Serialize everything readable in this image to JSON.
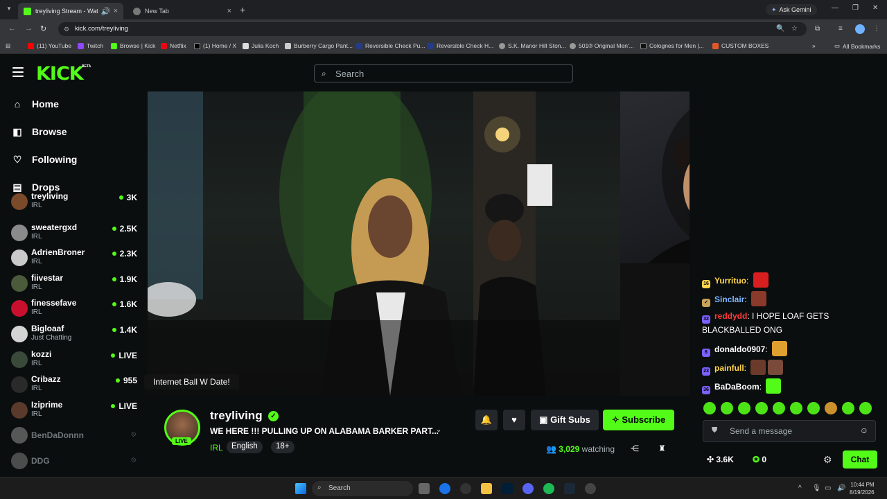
{
  "browser": {
    "tabs": [
      {
        "title": "treyliving Stream - Watch L",
        "active": true
      },
      {
        "title": "New Tab",
        "active": false
      }
    ],
    "ask_gemini": "Ask Gemini",
    "url": "kick.com/treyliving",
    "bookmarks": [
      "(11) YouTube",
      "Twitch",
      "Browse | Kick",
      "Netflix",
      "(1) Home / X",
      "Julia Koch",
      "Burberry Cargo Pant...",
      "Reversible Check Pu...",
      "Reversible Check H...",
      "S.K. Manor Hill Ston...",
      "501® Original Men'...",
      "Colognes for Men |...",
      "CUSTOM BOXES"
    ],
    "all_bookmarks": "All Bookmarks"
  },
  "kick": {
    "logo": "KICK",
    "beta": "BETA",
    "search_placeholder": "Search"
  },
  "sidebar": {
    "nav": [
      {
        "label": "Home",
        "icon": "home-icon"
      },
      {
        "label": "Browse",
        "icon": "browse-icon"
      },
      {
        "label": "Following",
        "icon": "heart-icon"
      },
      {
        "label": "Drops",
        "icon": "drops-icon"
      }
    ],
    "channels": [
      {
        "name": "treyliving",
        "category": "IRL",
        "viewers": "3K",
        "live": true,
        "color": "#7a4a2a"
      },
      {
        "name": "sweatergxd",
        "category": "IRL",
        "viewers": "2.5K",
        "live": true,
        "color": "#8a8a8a"
      },
      {
        "name": "AdrienBroner",
        "category": "IRL",
        "viewers": "2.3K",
        "live": true,
        "color": "#c9c9c9"
      },
      {
        "name": "fiivestar",
        "category": "IRL",
        "viewers": "1.9K",
        "live": true,
        "color": "#4a5a3a"
      },
      {
        "name": "finessefave",
        "category": "IRL",
        "viewers": "1.6K",
        "live": true,
        "color": "#c8102e"
      },
      {
        "name": "Bigloaaf",
        "category": "Just Chatting",
        "viewers": "1.4K",
        "live": true,
        "color": "#d4d4d4"
      },
      {
        "name": "kozzi",
        "category": "IRL",
        "viewers": "LIVE",
        "live": true,
        "color": "#3a4a3a"
      },
      {
        "name": "Cribazz",
        "category": "IRL",
        "viewers": "955",
        "live": true,
        "color": "#2a2a2a"
      },
      {
        "name": "Iziprime",
        "category": "IRL",
        "viewers": "LIVE",
        "live": true,
        "color": "#5a3a2a"
      },
      {
        "name": "BenDaDonnn",
        "category": "",
        "viewers": "",
        "live": false,
        "color": "#888"
      },
      {
        "name": "DDG",
        "category": "",
        "viewers": "",
        "live": false,
        "color": "#777"
      }
    ]
  },
  "player": {
    "caption": "Internet Ball W Date!"
  },
  "stream": {
    "streamer": "treyliving",
    "live_badge": "LIVE",
    "title": "WE HERE !!! PULLING UP ON ALABAMA BARKER PART...",
    "category": "IRL",
    "tags": [
      "English",
      "18+"
    ],
    "gift_subs": "Gift Subs",
    "subscribe": "Subscribe",
    "viewer_count": "3,029",
    "watching_label": "watching"
  },
  "chat": {
    "messages": [
      {
        "user": "Yurrituo",
        "color": "#ffd54a",
        "text": "",
        "badge": "#ffd54a",
        "emote": "#d81e1e"
      },
      {
        "user": "Sinclair",
        "color": "#7fb7ff",
        "text": "",
        "badge": "#c9a25a",
        "emote": "#8a3a2a"
      },
      {
        "user": "reddydd",
        "color": "#ff3a3a",
        "text": "I HOPE LOAF GETS BLACKBALLED ONG",
        "badge": "#7b61ff",
        "emote": ""
      },
      {
        "user": "donaldo0907",
        "color": "#ffffff",
        "text": "",
        "badge": "#7b61ff",
        "emote": "#e0a030"
      },
      {
        "user": "painfull",
        "color": "#ffd54a",
        "text": "",
        "badge": "#7b61ff",
        "emote": "#6a3a2a"
      },
      {
        "user": "BaDaBoom",
        "color": "#ffffff",
        "text": "",
        "badge": "#7b61ff",
        "emote": "#53fc18"
      }
    ],
    "input_placeholder": "Send a message",
    "stat_left": "3.6K",
    "stat_right": "0",
    "send_label": "Chat"
  },
  "taskbar": {
    "search": "Search",
    "time": "10:44 PM",
    "date": "8/19/2026"
  }
}
